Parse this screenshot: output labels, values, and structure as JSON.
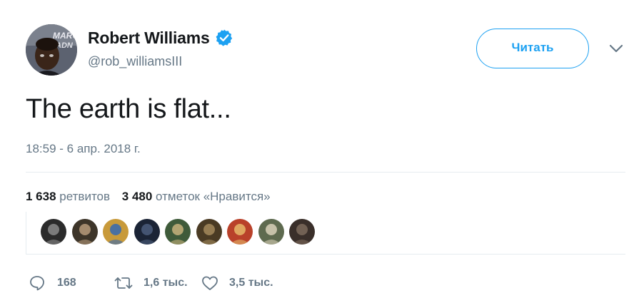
{
  "tweet": {
    "author": {
      "display_name": "Robert Williams",
      "handle": "@rob_williamsIII",
      "verified": true,
      "avatar_backdrop_text": "MARCH MADN"
    },
    "follow_label": "Читать",
    "text": "The earth is flat...",
    "timestamp": "18:59 - 6 апр. 2018 г.",
    "stats": {
      "retweets_count": "1 638",
      "retweets_label": "ретвитов",
      "likes_count": "3 480",
      "likes_label": "отметок «Нравится»"
    },
    "likers": [
      {
        "name": "liker-1",
        "colors": [
          "#2b2b2b",
          "#8a8a8a"
        ]
      },
      {
        "name": "liker-2",
        "colors": [
          "#3d3529",
          "#b69a7a"
        ]
      },
      {
        "name": "liker-3",
        "colors": [
          "#c89a3a",
          "#3469b4"
        ]
      },
      {
        "name": "liker-4",
        "colors": [
          "#1b2436",
          "#4b5d7c"
        ]
      },
      {
        "name": "liker-5",
        "colors": [
          "#3f5b3a",
          "#c7b37c"
        ]
      },
      {
        "name": "liker-6",
        "colors": [
          "#4a3b24",
          "#a38a5c"
        ]
      },
      {
        "name": "liker-7",
        "colors": [
          "#b9412a",
          "#e6b86a"
        ]
      },
      {
        "name": "liker-8",
        "colors": [
          "#5e6a4f",
          "#d8d0b8"
        ]
      },
      {
        "name": "liker-9",
        "colors": [
          "#3a2f2a",
          "#7d6a5c"
        ]
      }
    ],
    "actions": {
      "reply_count": "168",
      "retweet_count": "1,6 тыс.",
      "like_count": "3,5 тыс."
    }
  },
  "colors": {
    "accent": "#1da1f2",
    "text_primary": "#14171a",
    "text_secondary": "#657786",
    "divider": "#e6ecf0"
  },
  "icons": {
    "verified": "verified-badge-icon",
    "caret": "chevron-down-icon",
    "reply": "speech-bubble-icon",
    "retweet": "retweet-arrows-icon",
    "like": "heart-outline-icon"
  }
}
